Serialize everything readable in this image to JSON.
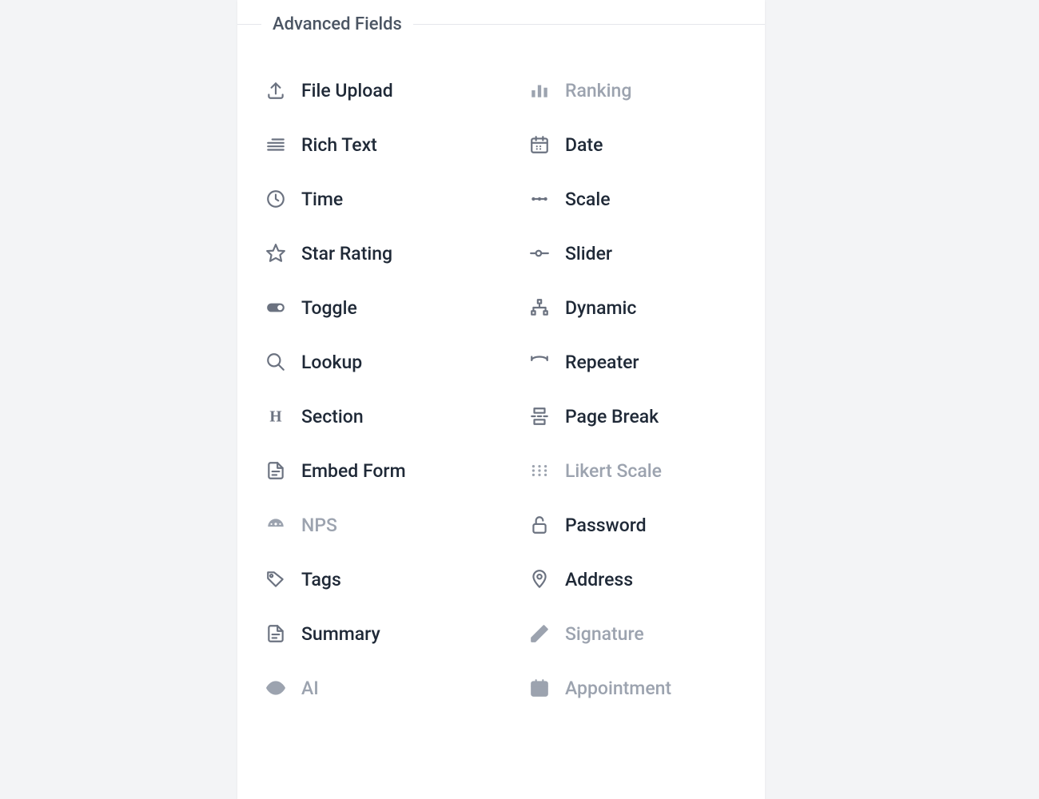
{
  "section": {
    "title": "Advanced Fields"
  },
  "fields": [
    {
      "label": "File Upload",
      "icon": "upload-icon",
      "disabled": false
    },
    {
      "label": "Ranking",
      "icon": "ranking-icon",
      "disabled": true
    },
    {
      "label": "Rich Text",
      "icon": "rich-text-icon",
      "disabled": false
    },
    {
      "label": "Date",
      "icon": "calendar-icon",
      "disabled": false
    },
    {
      "label": "Time",
      "icon": "clock-icon",
      "disabled": false
    },
    {
      "label": "Scale",
      "icon": "scale-icon",
      "disabled": false
    },
    {
      "label": "Star Rating",
      "icon": "star-icon",
      "disabled": false
    },
    {
      "label": "Slider",
      "icon": "slider-icon",
      "disabled": false
    },
    {
      "label": "Toggle",
      "icon": "toggle-icon",
      "disabled": false
    },
    {
      "label": "Dynamic",
      "icon": "dynamic-icon",
      "disabled": false
    },
    {
      "label": "Lookup",
      "icon": "search-icon",
      "disabled": false
    },
    {
      "label": "Repeater",
      "icon": "repeater-icon",
      "disabled": false
    },
    {
      "label": "Section",
      "icon": "heading-icon",
      "disabled": false
    },
    {
      "label": "Page Break",
      "icon": "page-break-icon",
      "disabled": false
    },
    {
      "label": "Embed Form",
      "icon": "file-icon",
      "disabled": false
    },
    {
      "label": "Likert Scale",
      "icon": "likert-icon",
      "disabled": true
    },
    {
      "label": "NPS",
      "icon": "gauge-icon",
      "disabled": true
    },
    {
      "label": "Password",
      "icon": "lock-icon",
      "disabled": false
    },
    {
      "label": "Tags",
      "icon": "tag-icon",
      "disabled": false
    },
    {
      "label": "Address",
      "icon": "pin-icon",
      "disabled": false
    },
    {
      "label": "Summary",
      "icon": "file-icon",
      "disabled": false
    },
    {
      "label": "Signature",
      "icon": "pen-icon",
      "disabled": true
    },
    {
      "label": "AI",
      "icon": "eye-icon",
      "disabled": true
    },
    {
      "label": "Appointment",
      "icon": "calendar-icon",
      "disabled": true
    }
  ]
}
